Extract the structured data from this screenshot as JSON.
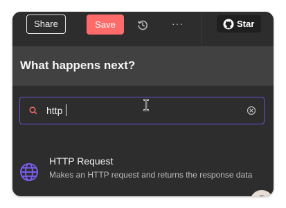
{
  "toolbar": {
    "share_label": "Share",
    "save_label": "Save",
    "more_label": "···",
    "star_label": "Star",
    "save_color": "#ff6b6b"
  },
  "icons": {
    "history": "history-icon",
    "more": "more-horizontal-icon",
    "github": "github-icon",
    "search": "search-icon",
    "clear": "clear-circle-icon",
    "globe": "globe-icon",
    "cursor": "text-cursor-icon"
  },
  "panel": {
    "title": "What happens next?",
    "search": {
      "value": "http",
      "accent_color": "#6b4fd8"
    },
    "results": [
      {
        "title": "HTTP Request",
        "description": "Makes an HTTP request and returns the response data",
        "icon": "globe-icon",
        "icon_color": "#7b5cf0"
      }
    ]
  }
}
